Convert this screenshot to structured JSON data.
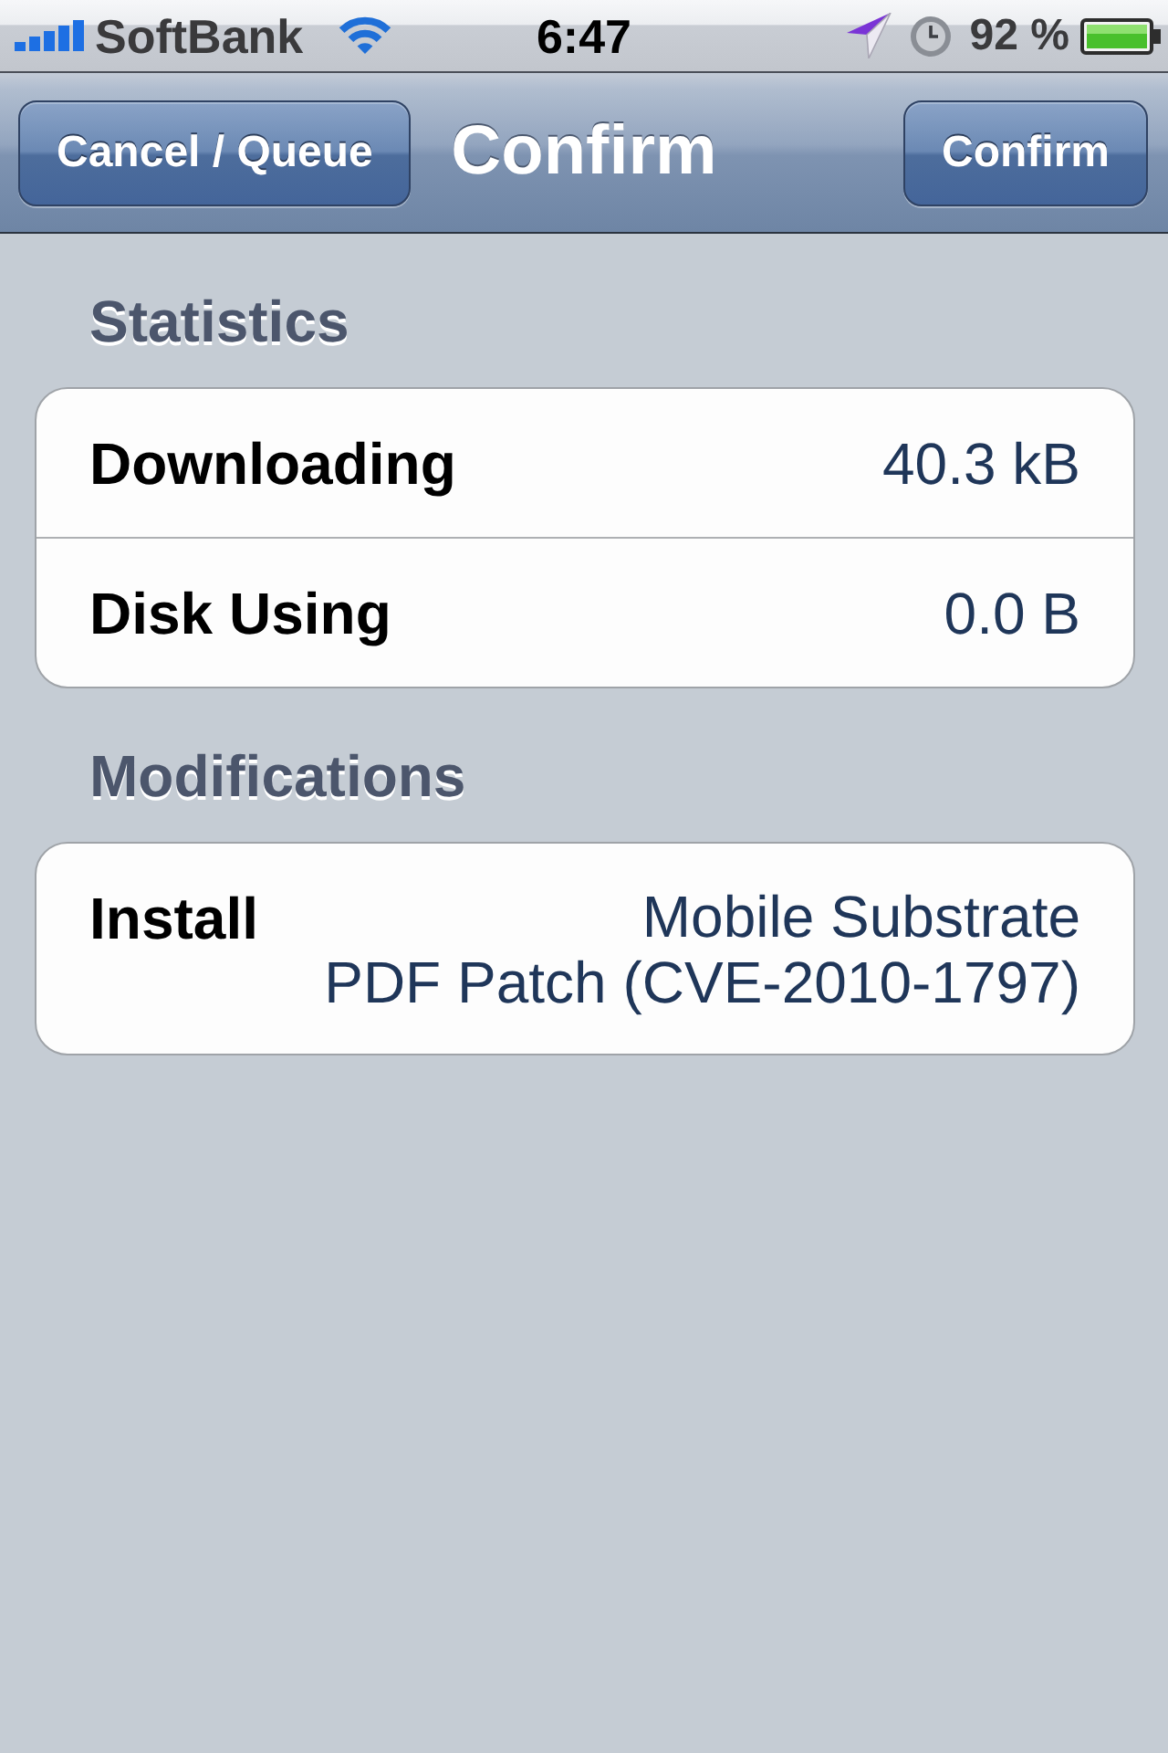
{
  "status_bar": {
    "carrier": "SoftBank",
    "time": "6:47",
    "battery": "92 %"
  },
  "nav_bar": {
    "left_button": "Cancel / Queue",
    "title": "Confirm",
    "right_button": "Confirm"
  },
  "sections": [
    {
      "header": "Statistics",
      "rows": [
        {
          "label": "Downloading",
          "value": "40.3 kB"
        },
        {
          "label": "Disk Using",
          "value": "0.0 B"
        }
      ]
    },
    {
      "header": "Modifications",
      "rows": [
        {
          "label": "Install",
          "value": "Mobile Substrate\nPDF Patch (CVE-2010-1797)"
        }
      ]
    }
  ]
}
